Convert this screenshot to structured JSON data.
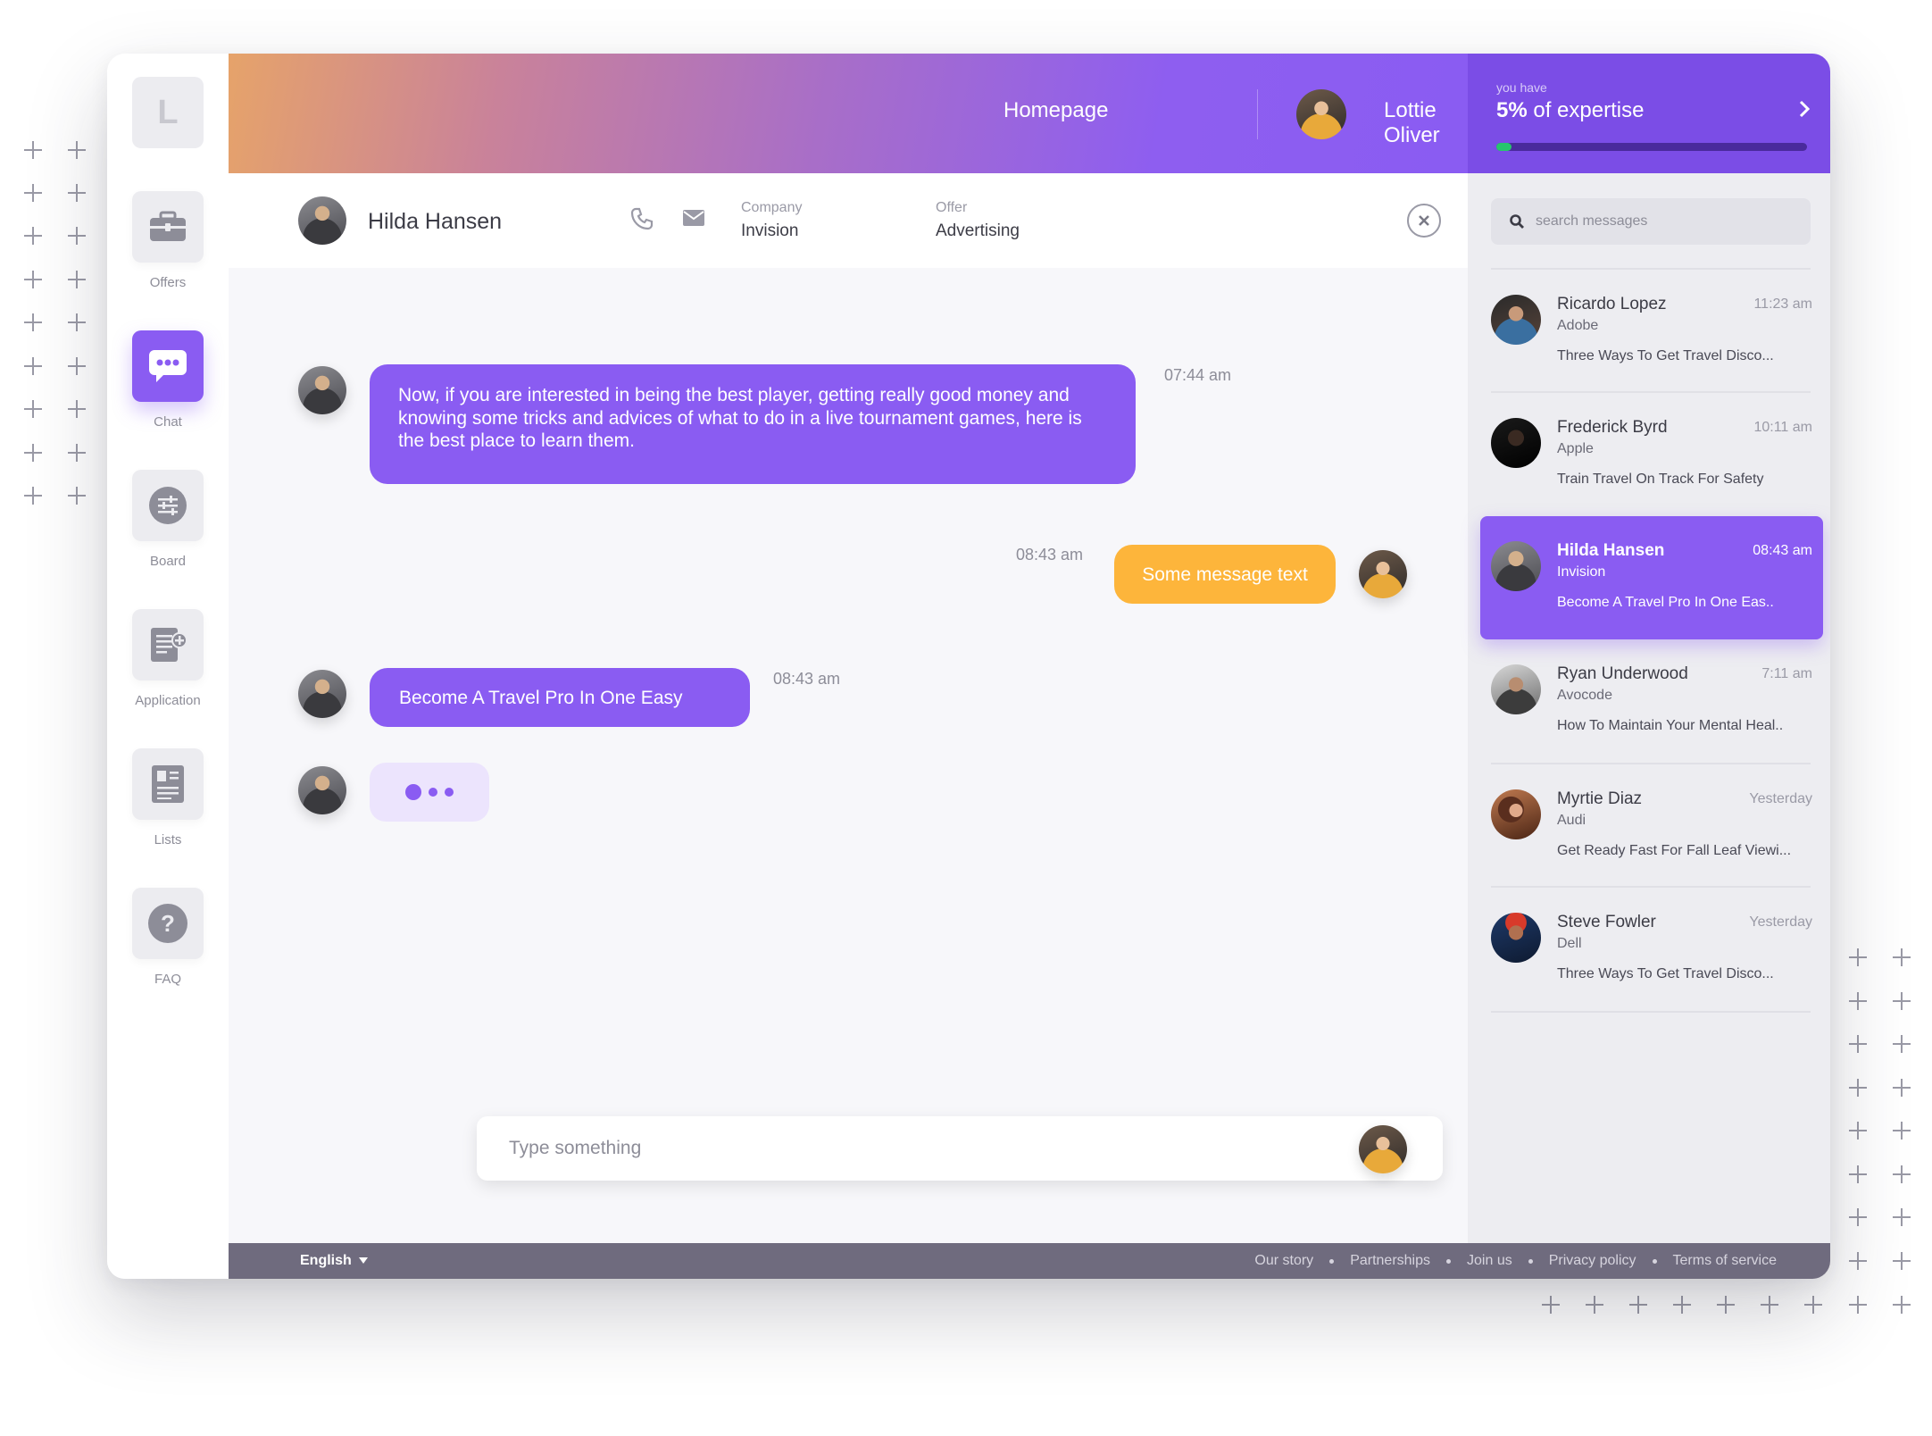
{
  "colors": {
    "accent": "#8a5cf2",
    "accent_dark": "#7b4de6",
    "orange": "#fdb53b",
    "progress_fill": "#27c56e",
    "footer_bg": "#6f6b7e"
  },
  "sidebar": {
    "logo": "L",
    "items": [
      {
        "label": "Offers",
        "icon": "briefcase-icon"
      },
      {
        "label": "Chat",
        "icon": "chat-bubble-icon",
        "active": true
      },
      {
        "label": "Board",
        "icon": "sliders-icon"
      },
      {
        "label": "Application",
        "icon": "document-add-icon"
      },
      {
        "label": "Lists",
        "icon": "contact-list-icon"
      },
      {
        "label": "FAQ",
        "icon": "question-icon"
      }
    ]
  },
  "header": {
    "homepage_label": "Homepage",
    "user_name": "Lottie Oliver",
    "expertise": {
      "small_label": "you have",
      "percent_text": "5%",
      "suffix": "of expertise",
      "progress": 0.05
    }
  },
  "chat_header": {
    "name": "Hilda Hansen",
    "company_label": "Company",
    "company_value": "Invision",
    "offer_label": "Offer",
    "offer_value": "Advertising"
  },
  "messages": [
    {
      "from": "them",
      "text": "Now, if you are interested in being the best player, getting really good money and knowing some tricks and advices of what to do in a live tournament games, here is the best place to learn them.",
      "time": "07:44 am"
    },
    {
      "from": "me",
      "text": "Some message text",
      "time": "08:43 am"
    },
    {
      "from": "them",
      "text": "Become A Travel Pro In One Easy",
      "time": "08:43 am"
    }
  ],
  "composer": {
    "placeholder": "Type something"
  },
  "search": {
    "placeholder": "search messages"
  },
  "conversations": [
    {
      "name": "Ricardo Lopez",
      "company": "Adobe",
      "time": "11:23 am",
      "preview": "Three Ways To Get Travel Disco..."
    },
    {
      "name": "Frederick Byrd",
      "company": "Apple",
      "time": "10:11 am",
      "preview": "Train Travel On Track For Safety"
    },
    {
      "name": "Hilda Hansen",
      "company": "Invision",
      "time": "08:43 am",
      "preview": "Become A Travel Pro In One Eas..",
      "active": true
    },
    {
      "name": "Ryan Underwood",
      "company": "Avocode",
      "time": "7:11 am",
      "preview": "How To Maintain Your Mental Heal.."
    },
    {
      "name": "Myrtie Diaz",
      "company": "Audi",
      "time": "Yesterday",
      "preview": "Get Ready Fast For Fall Leaf Viewi..."
    },
    {
      "name": "Steve Fowler",
      "company": "Dell",
      "time": "Yesterday",
      "preview": "Three Ways To Get Travel Disco..."
    }
  ],
  "footer": {
    "language": "English",
    "links": [
      "Our story",
      "Partnerships",
      "Join us",
      "Privacy policy",
      "Terms of service"
    ]
  }
}
